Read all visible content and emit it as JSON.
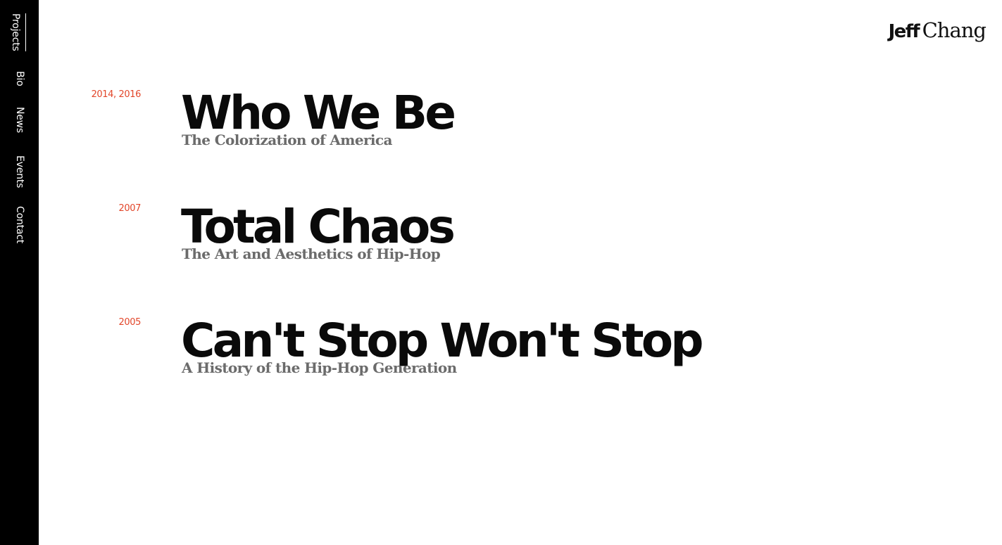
{
  "nav": {
    "items": [
      {
        "label": "Projects",
        "active": true
      },
      {
        "label": "Bio",
        "active": false
      },
      {
        "label": "News",
        "active": false
      },
      {
        "label": "Events",
        "active": false
      },
      {
        "label": "Contact",
        "active": false
      }
    ]
  },
  "logo": {
    "first": "Jeff",
    "last": "Chang"
  },
  "projects": [
    {
      "year": "2014, 2016",
      "title": "Who We Be",
      "subtitle": "The Colorization of America"
    },
    {
      "year": "2007",
      "title": "Total Chaos",
      "subtitle": "The Art and Aesthetics of Hip-Hop"
    },
    {
      "year": "2005",
      "title": "Can't Stop Won't Stop",
      "subtitle": "A History of the Hip-Hop Generation"
    }
  ],
  "colors": {
    "sidebar": "#000000",
    "accent_year": "#e2462a",
    "title": "#0a0a0a",
    "subtitle": "#6b6b6b"
  }
}
